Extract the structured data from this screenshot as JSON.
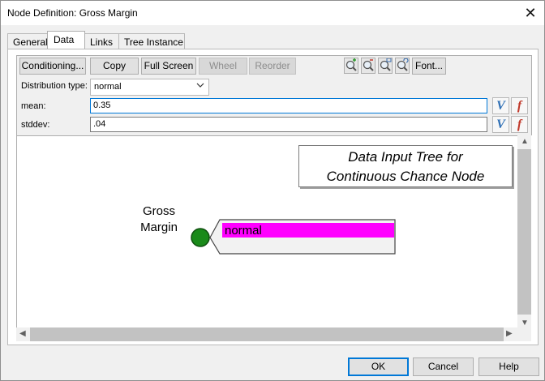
{
  "window": {
    "title": "Node Definition: Gross Margin",
    "close_glyph": "✕"
  },
  "tabs": [
    {
      "label": "General"
    },
    {
      "label": "Data"
    },
    {
      "label": "Links"
    },
    {
      "label": "Tree Instance"
    }
  ],
  "toolbar": {
    "conditioning": "Conditioning...",
    "copy": "Copy",
    "full_screen": "Full Screen",
    "wheel": "Wheel",
    "reorder": "Reorder",
    "font": "Font...",
    "zoom_icons": [
      "zoom-in-icon",
      "zoom-out-icon",
      "zoom-fit-icon",
      "zoom-reset-icon"
    ]
  },
  "fields": {
    "distribution_label": "Distribution type:",
    "distribution_value": "normal",
    "mean_label": "mean:",
    "mean_value": "0.35",
    "stddev_label": "stddev:",
    "stddev_value": ".04",
    "v_glyph": "V",
    "f_glyph": "f"
  },
  "canvas": {
    "info_line1": "Data Input Tree for",
    "info_line2": "Continuous Chance Node",
    "node_label_line1": "Gross",
    "node_label_line2": "Margin",
    "branch_label": "normal",
    "node_color": "#1a8a1a",
    "branch_highlight": "#ff00ff"
  },
  "buttons": {
    "ok": "OK",
    "cancel": "Cancel",
    "help": "Help"
  },
  "colors": {
    "focus": "#0078d7",
    "v_color": "#2e6fb5",
    "f_color": "#c0392b"
  }
}
